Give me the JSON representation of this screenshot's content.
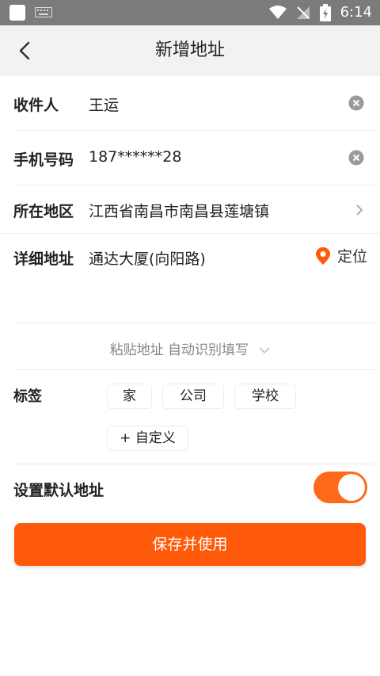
{
  "status_bar": {
    "time": "6:14"
  },
  "header": {
    "title": "新增地址"
  },
  "form": {
    "recipient": {
      "label": "收件人",
      "value": "王运"
    },
    "phone": {
      "label": "手机号码",
      "value": "187******28"
    },
    "region": {
      "label": "所在地区",
      "value": "江西省南昌市南昌县莲塘镇"
    },
    "detail": {
      "label": "详细地址",
      "value": "通达大厦(向阳路)",
      "locate_label": "定位"
    },
    "paste": {
      "label": "粘贴地址 自动识别填写"
    },
    "tags": {
      "label": "标签",
      "options": [
        "家",
        "公司",
        "学校",
        "+ 自定义"
      ]
    },
    "default_address": {
      "label": "设置默认地址",
      "enabled": true
    },
    "submit": {
      "label": "保存并使用"
    }
  },
  "colors": {
    "accent": "#ff5a0a",
    "toggle": "#ff6a1a",
    "status_bar": "#7b7b7b",
    "header_bg": "#f2f2f2"
  },
  "icons": [
    "back-icon",
    "clear-icon",
    "chevron-right-icon",
    "location-pin-icon",
    "chevron-down-icon",
    "wifi-icon",
    "signal-icon",
    "battery-icon",
    "keyboard-icon"
  ]
}
